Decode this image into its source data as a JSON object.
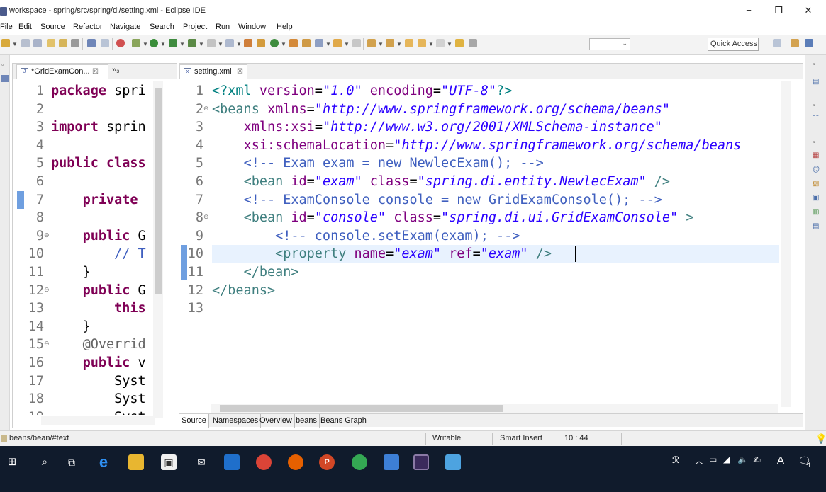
{
  "window": {
    "title": "workspace - spring/src/spring/di/setting.xml - Eclipse IDE",
    "minimize": "−",
    "maximize": "❐",
    "close": "✕"
  },
  "menu": [
    "File",
    "Edit",
    "Source",
    "Refactor",
    "Navigate",
    "Search",
    "Project",
    "Run",
    "Window",
    "Help"
  ],
  "toolbar": {
    "quick_access_placeholder": "Quick Access"
  },
  "left_editor": {
    "tab_label": "*GridExamCon...",
    "tab_close": "☒",
    "overflow": "»₃",
    "lines": [
      {
        "n": "1",
        "marker": "",
        "tokens": [
          [
            "kw",
            "package"
          ],
          [
            "plain",
            " spri"
          ]
        ]
      },
      {
        "n": "2",
        "marker": "",
        "tokens": []
      },
      {
        "n": "3",
        "marker": "",
        "tokens": [
          [
            "kw",
            "import"
          ],
          [
            "plain",
            " sprin"
          ]
        ]
      },
      {
        "n": "4",
        "marker": "",
        "tokens": []
      },
      {
        "n": "5",
        "marker": "",
        "tokens": [
          [
            "kw",
            "public class"
          ]
        ]
      },
      {
        "n": "6",
        "marker": "",
        "tokens": []
      },
      {
        "n": "7",
        "marker": "",
        "tokens": [
          [
            "plain",
            "    "
          ],
          [
            "kw",
            "private"
          ]
        ]
      },
      {
        "n": "8",
        "marker": "",
        "tokens": []
      },
      {
        "n": "9",
        "marker": "⊖",
        "tokens": [
          [
            "plain",
            "    "
          ],
          [
            "kw",
            "public"
          ],
          [
            "plain",
            " G"
          ]
        ]
      },
      {
        "n": "10",
        "marker": "",
        "tokens": [
          [
            "plain",
            "        "
          ],
          [
            "cmt",
            "// T"
          ]
        ]
      },
      {
        "n": "11",
        "marker": "",
        "tokens": [
          [
            "plain",
            "    }"
          ]
        ]
      },
      {
        "n": "12",
        "marker": "⊖",
        "tokens": [
          [
            "plain",
            "    "
          ],
          [
            "kw",
            "public"
          ],
          [
            "plain",
            " G"
          ]
        ]
      },
      {
        "n": "13",
        "marker": "",
        "tokens": [
          [
            "plain",
            "        "
          ],
          [
            "kw",
            "this"
          ]
        ]
      },
      {
        "n": "14",
        "marker": "",
        "tokens": [
          [
            "plain",
            "    }"
          ]
        ]
      },
      {
        "n": "15",
        "marker": "⊖",
        "tokens": [
          [
            "plain",
            "    "
          ],
          [
            "annot",
            "@Overrid"
          ]
        ]
      },
      {
        "n": "16",
        "marker": "",
        "tokens": [
          [
            "plain",
            "    "
          ],
          [
            "kw",
            "public"
          ],
          [
            "plain",
            " v"
          ]
        ]
      },
      {
        "n": "17",
        "marker": "",
        "tokens": [
          [
            "plain",
            "        Syst"
          ]
        ]
      },
      {
        "n": "18",
        "marker": "",
        "tokens": [
          [
            "plain",
            "        Syst"
          ]
        ]
      },
      {
        "n": "19",
        "marker": "",
        "tokens": [
          [
            "plain",
            "        Syst"
          ]
        ]
      }
    ]
  },
  "xml_editor": {
    "tab_label": "setting.xml",
    "tab_close": "☒",
    "lines": [
      {
        "n": "1",
        "marker": "",
        "tokens": [
          [
            "pi",
            "<?xml "
          ],
          [
            "attr",
            "version"
          ],
          [
            "plain",
            "="
          ],
          [
            "val",
            "\"1.0\""
          ],
          [
            "plain",
            " "
          ],
          [
            "attr",
            "encoding"
          ],
          [
            "plain",
            "="
          ],
          [
            "val",
            "\"UTF-8\""
          ],
          [
            "pi",
            "?>"
          ]
        ]
      },
      {
        "n": "2",
        "marker": "⊖",
        "tokens": [
          [
            "tag",
            "<beans "
          ],
          [
            "attr",
            "xmlns"
          ],
          [
            "plain",
            "="
          ],
          [
            "val",
            "\"http://www.springframework.org/schema/beans\""
          ]
        ]
      },
      {
        "n": "3",
        "marker": "",
        "tokens": [
          [
            "plain",
            "    "
          ],
          [
            "attr",
            "xmlns:xsi"
          ],
          [
            "plain",
            "="
          ],
          [
            "val",
            "\"http://www.w3.org/2001/XMLSchema-instance\""
          ]
        ]
      },
      {
        "n": "4",
        "marker": "",
        "tokens": [
          [
            "plain",
            "    "
          ],
          [
            "attr",
            "xsi:schemaLocation"
          ],
          [
            "plain",
            "="
          ],
          [
            "val",
            "\"http://www.springframework.org/schema/beans"
          ]
        ]
      },
      {
        "n": "5",
        "marker": "",
        "tokens": [
          [
            "plain",
            "    "
          ],
          [
            "cmt",
            "<!-- Exam exam = new NewlecExam(); -->"
          ]
        ]
      },
      {
        "n": "6",
        "marker": "",
        "tokens": [
          [
            "plain",
            "    "
          ],
          [
            "tag",
            "<bean "
          ],
          [
            "attr",
            "id"
          ],
          [
            "plain",
            "="
          ],
          [
            "val",
            "\"exam\""
          ],
          [
            "plain",
            " "
          ],
          [
            "attr",
            "class"
          ],
          [
            "plain",
            "="
          ],
          [
            "val",
            "\"spring.di.entity.NewlecExam\""
          ],
          [
            "tag",
            " />"
          ]
        ]
      },
      {
        "n": "7",
        "marker": "",
        "tokens": [
          [
            "plain",
            "    "
          ],
          [
            "cmt",
            "<!-- ExamConsole console = new GridExamConsole(); -->"
          ]
        ]
      },
      {
        "n": "8",
        "marker": "⊖",
        "tokens": [
          [
            "plain",
            "    "
          ],
          [
            "tag",
            "<bean "
          ],
          [
            "attr",
            "id"
          ],
          [
            "plain",
            "="
          ],
          [
            "val",
            "\"console\""
          ],
          [
            "plain",
            " "
          ],
          [
            "attr",
            "class"
          ],
          [
            "plain",
            "="
          ],
          [
            "val",
            "\"spring.di.ui.GridExamConsole\""
          ],
          [
            "tag",
            " >"
          ]
        ]
      },
      {
        "n": "9",
        "marker": "",
        "tokens": [
          [
            "plain",
            "        "
          ],
          [
            "cmt",
            "<!-- console.setExam(exam); -->"
          ]
        ]
      },
      {
        "n": "10",
        "marker": "",
        "tokens": [
          [
            "plain",
            "        "
          ],
          [
            "tag",
            "<property "
          ],
          [
            "attr",
            "name"
          ],
          [
            "plain",
            "="
          ],
          [
            "val",
            "\"exam\""
          ],
          [
            "plain",
            " "
          ],
          [
            "attr",
            "ref"
          ],
          [
            "plain",
            "="
          ],
          [
            "val",
            "\"exam\""
          ],
          [
            "tag",
            " />"
          ]
        ]
      },
      {
        "n": "11",
        "marker": "",
        "tokens": [
          [
            "plain",
            "    "
          ],
          [
            "tag",
            "</bean>"
          ]
        ]
      },
      {
        "n": "12",
        "marker": "",
        "tokens": [
          [
            "tag",
            "</beans>"
          ]
        ]
      },
      {
        "n": "13",
        "marker": "",
        "tokens": []
      }
    ],
    "bottom_tabs": [
      "Source",
      "Namespaces",
      "Overview",
      "beans",
      "Beans Graph"
    ]
  },
  "status": {
    "path": "beans/bean/#text",
    "writable": "Writable",
    "insert_mode": "Smart Insert",
    "position": "10 : 44"
  },
  "taskbar": {
    "ime_indicator": "A",
    "notification_count": "1"
  }
}
